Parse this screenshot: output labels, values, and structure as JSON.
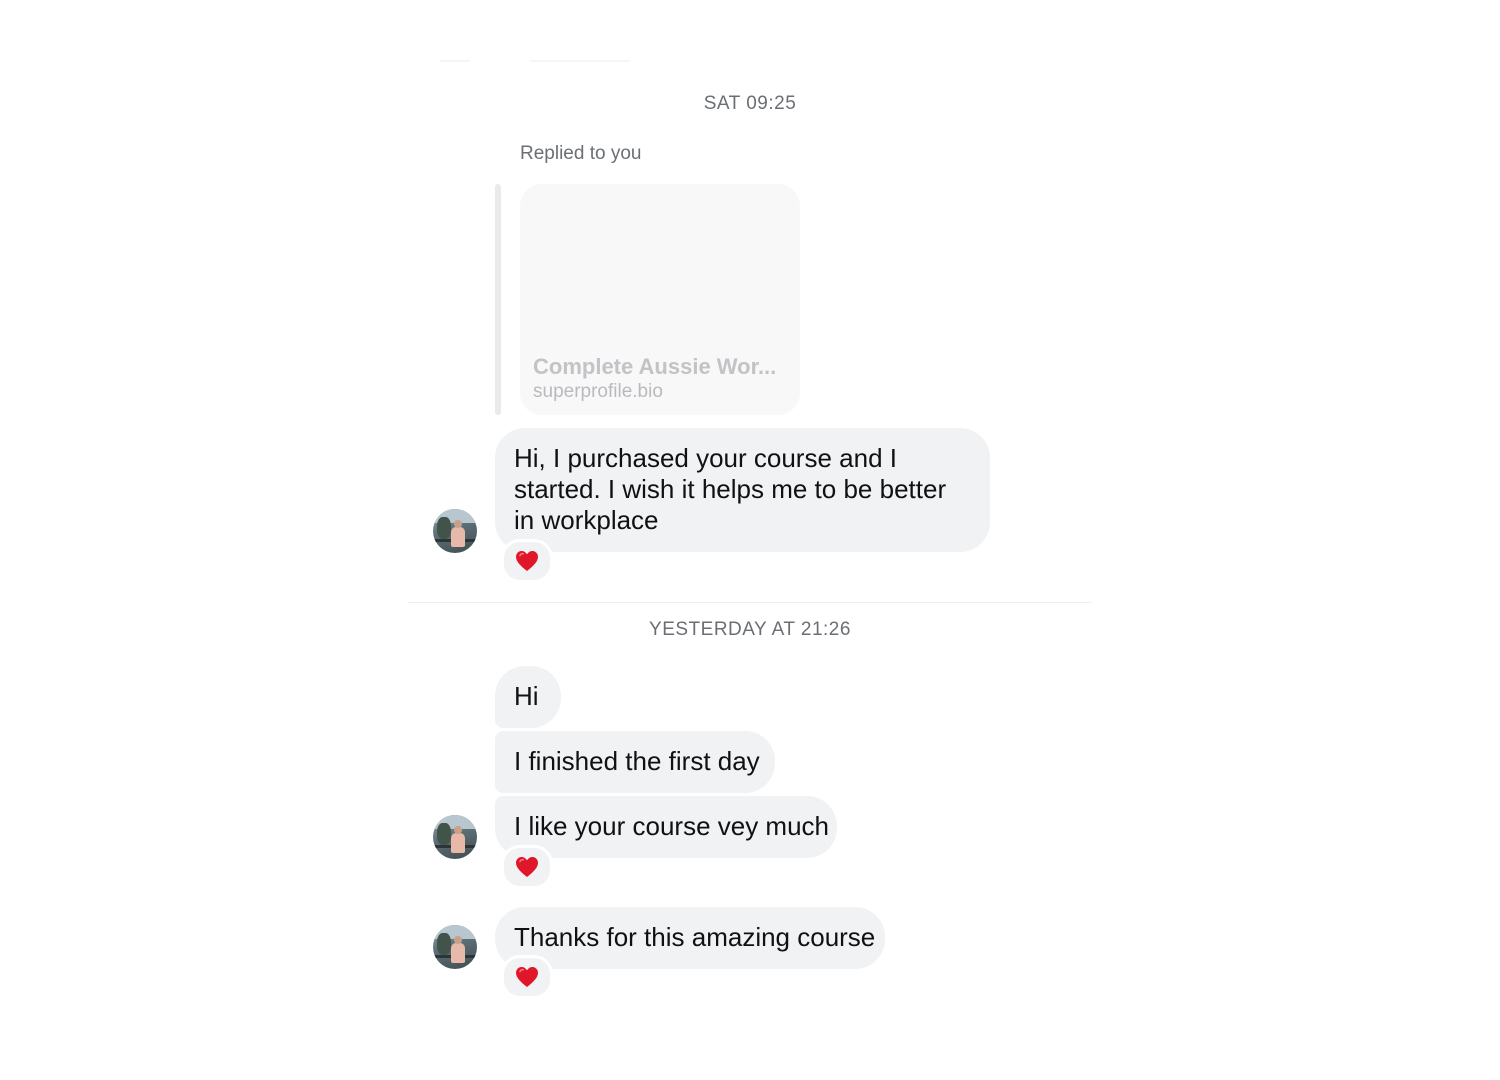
{
  "thread": {
    "groups": [
      {
        "timestamp": "SAT 09:25",
        "reply": {
          "label": "Replied to you",
          "link_title": "Complete Aussie Wor...",
          "link_domain": "superprofile.bio"
        },
        "messages": [
          {
            "text": "Hi, I purchased your course and I started. I wish it helps me to be better in workplace",
            "reaction": "heart-icon"
          }
        ]
      },
      {
        "timestamp": "YESTERDAY AT 21:26",
        "messages": [
          {
            "text": "Hi"
          },
          {
            "text": "I finished the first day"
          },
          {
            "text": "I like your course vey much",
            "reaction": "heart-icon"
          },
          {
            "text": "Thanks for this amazing course",
            "reaction": "heart-icon"
          }
        ]
      }
    ]
  },
  "colors": {
    "bubble": "#f1f2f4",
    "timestamp_text": "#6b6f75",
    "reaction_heart": "#e0162b"
  }
}
